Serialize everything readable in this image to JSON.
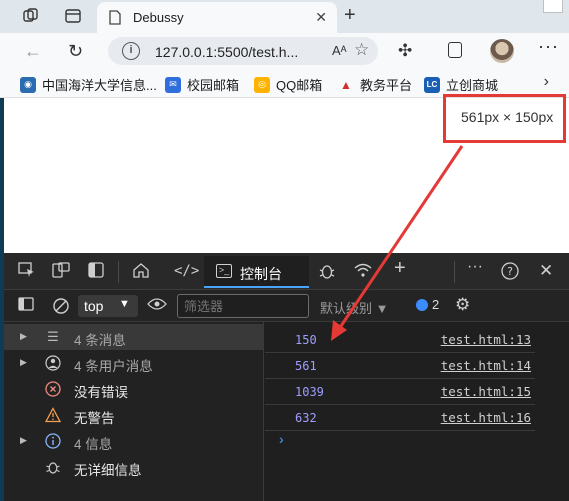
{
  "browser": {
    "tab_title": "Debussy",
    "url": "127.0.0.1:5500/test.h...",
    "read_aloud_label": "Aᴬ"
  },
  "bookmarks": [
    {
      "label": "中国海洋大学信息...",
      "icon_color": "#2b6cb0",
      "icon_glyph": "◉"
    },
    {
      "label": "校园邮箱",
      "icon_color": "#2f6fdd",
      "icon_glyph": "✉"
    },
    {
      "label": "QQ邮箱",
      "icon_color": "#ffb300",
      "icon_glyph": "◎"
    },
    {
      "label": "教务平台",
      "icon_color": "#d32f2f",
      "icon_glyph": "▲"
    },
    {
      "label": "立创商城",
      "icon_color": "#1a5fb4",
      "icon_glyph": "LC"
    }
  ],
  "page": {
    "dimension_overlay": "561px × 150px"
  },
  "devtools": {
    "console_tab": "控制台",
    "context": "top",
    "filter_placeholder": "筛选器",
    "levels": "默认级别 ▼",
    "issues_count": "2",
    "sidebar": [
      {
        "label": "4 条消息",
        "icon": "list-icon",
        "glyph": "☰",
        "has_arrow": true,
        "muted": true
      },
      {
        "label": "4 条用户消息",
        "icon": "user-icon",
        "glyph": "●",
        "has_arrow": true,
        "muted": true
      },
      {
        "label": "没有错误",
        "icon": "error-icon",
        "glyph": "✕",
        "has_arrow": false,
        "muted": false
      },
      {
        "label": "无警告",
        "icon": "warning-icon",
        "glyph": "⚠",
        "has_arrow": false,
        "muted": false
      },
      {
        "label": "4 信息",
        "icon": "info-icon",
        "glyph": "i",
        "has_arrow": true,
        "muted": true
      },
      {
        "label": "无详细信息",
        "icon": "bug-icon",
        "glyph": "✱",
        "has_arrow": false,
        "muted": false
      }
    ],
    "logs": [
      {
        "value": "150",
        "source": "test.html:13"
      },
      {
        "value": "561",
        "source": "test.html:14"
      },
      {
        "value": "1039",
        "source": "test.html:15"
      },
      {
        "value": "632",
        "source": "test.html:16"
      }
    ]
  },
  "colors": {
    "annotation": "#e53935",
    "log_value": "#9e9eff",
    "accent": "#4aa3ff"
  }
}
